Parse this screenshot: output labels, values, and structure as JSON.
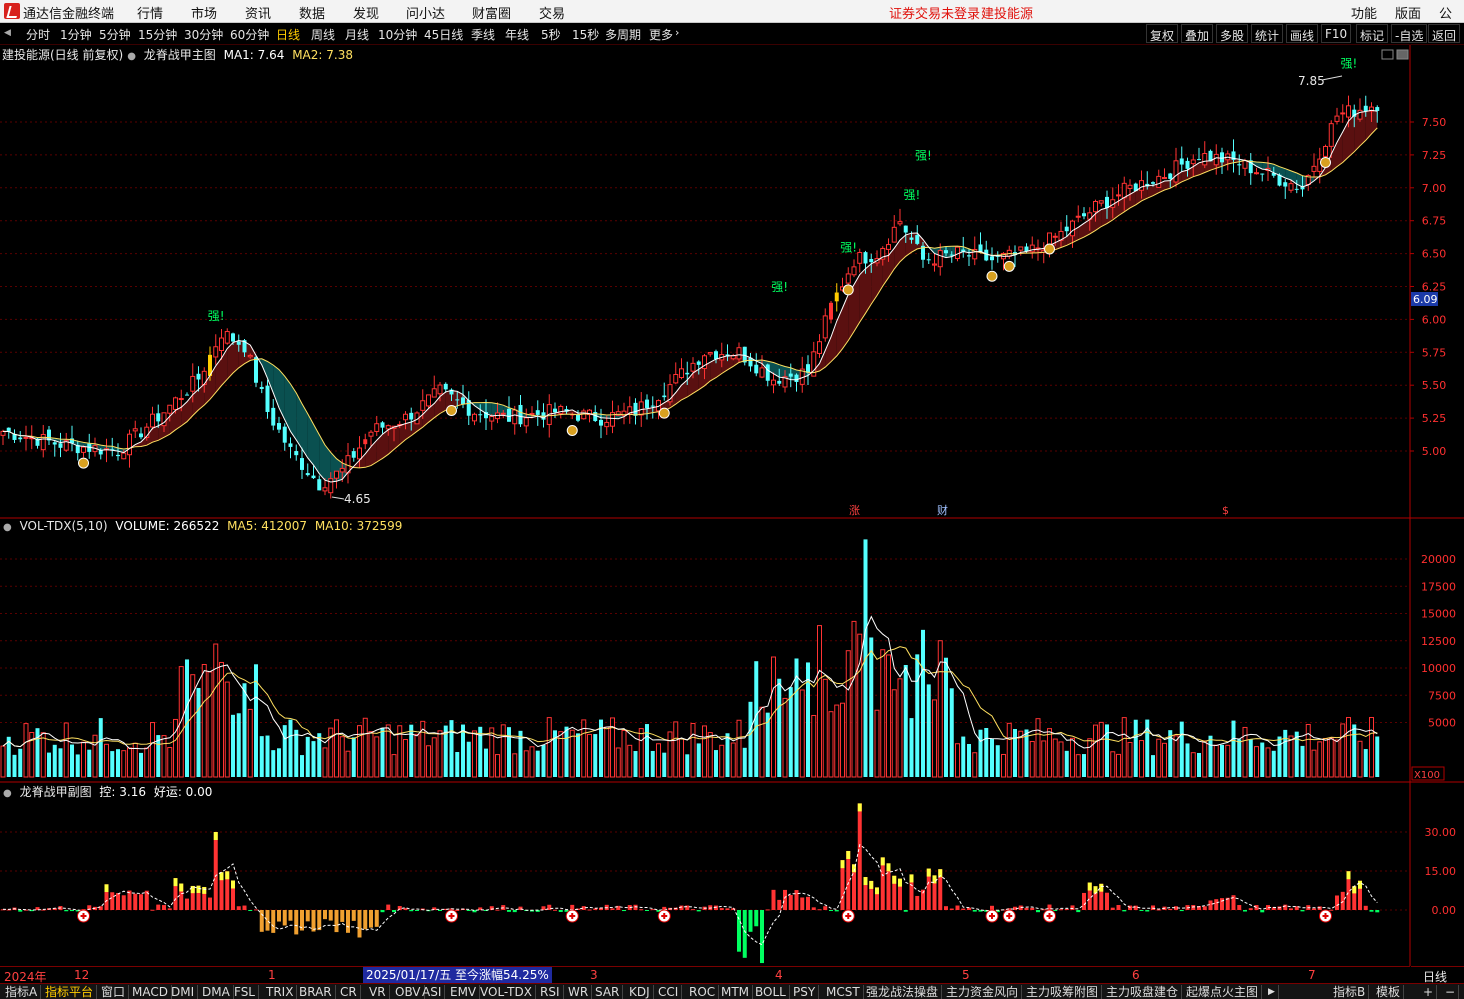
{
  "app": {
    "title": "通达信金融终端",
    "status_warning": "证券交易未登录",
    "status_stock": "建投能源"
  },
  "menus": [
    "行情",
    "市场",
    "资讯",
    "数据",
    "发现",
    "问小达",
    "财富圈",
    "交易"
  ],
  "right_menus": [
    "功能",
    "版面",
    "公式"
  ],
  "periods": [
    "分时",
    "1分钟",
    "5分钟",
    "15分钟",
    "30分钟",
    "60分钟",
    "日线",
    "周线",
    "月线",
    "10分钟",
    "45日线",
    "季线",
    "年线",
    "5秒",
    "15秒",
    "多周期",
    "更多"
  ],
  "active_period": "日线",
  "toolbar_buttons": [
    "复权",
    "叠加",
    "多股",
    "统计",
    "画线",
    "F10",
    "标记",
    "-自选",
    "返回"
  ],
  "main_panel": {
    "stock_label": "建投能源(日线 前复权)",
    "indicator": "龙脊战甲主图",
    "ma1": "MA1: 7.64",
    "ma2": "MA2: 7.38",
    "high_label": "7.85",
    "low_label": "4.65",
    "strong_label": "强!",
    "price_box": "6.09",
    "price_ticks": [
      "7.50",
      "7.25",
      "7.00",
      "6.75",
      "6.50",
      "6.25",
      "6.00",
      "5.75",
      "5.50",
      "5.25",
      "5.00"
    ],
    "event_markers": [
      {
        "text": "涨",
        "color": "#ff4040"
      },
      {
        "text": "财",
        "color": "#9fc0ff"
      },
      {
        "text": "$",
        "color": "#ff4040"
      }
    ]
  },
  "vol_panel": {
    "title": "VOL-TDX(5,10)",
    "volume": "VOLUME: 266522",
    "ma5": "MA5: 412007",
    "ma10": "MA10: 372599",
    "ticks": [
      "20000",
      "17500",
      "15000",
      "12500",
      "10000",
      "7500",
      "5000"
    ],
    "unit": "X100"
  },
  "sub_panel": {
    "title": "龙脊战甲副图",
    "kong": "控: 3.16",
    "haoyun": "好运: 0.00",
    "ticks": [
      "30.00",
      "15.00",
      "0.00"
    ]
  },
  "date_bar": {
    "labels": [
      "2024年",
      "12",
      "1",
      "3",
      "4",
      "5",
      "6",
      "7"
    ],
    "range_text": "2025/01/17/五  至今涨幅54.25%",
    "right_label": "日线"
  },
  "tabs": [
    "指标A",
    "指标平台",
    "窗口",
    "MACD",
    "DMI",
    "DMA",
    "FSL",
    "TRIX",
    "BRAR",
    "CR",
    "VR",
    "OBV",
    "ASI",
    "EMV",
    "VOL-TDX",
    "RSI",
    "WR",
    "SAR",
    "KDJ",
    "CCI",
    "ROC",
    "MTM",
    "BOLL",
    "PSY",
    "MCST",
    "强龙战法操盘",
    "主力资金风向",
    "主力吸筹附图",
    "主力吸盘建仓",
    "起爆点火主图"
  ],
  "active_tab": "指标平台",
  "right_tabs": [
    "指标B",
    "模板"
  ],
  "colors": {
    "up": "#ff3333",
    "down": "#54ffff",
    "ma1": "#ffffff",
    "ma2": "#ffe060",
    "axis": "#ff2020",
    "gold": "#ffcc00",
    "green": "#00ff60"
  }
}
